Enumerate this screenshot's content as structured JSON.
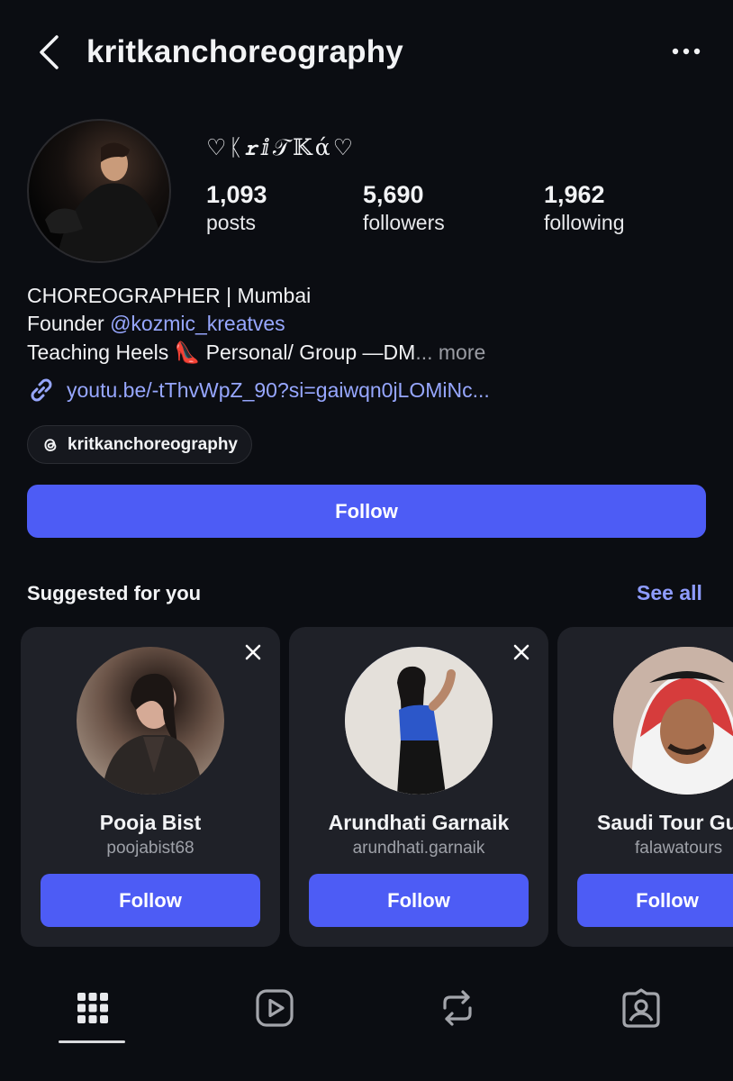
{
  "header": {
    "username": "kritkanchoreography",
    "back_icon": "chevron-left-icon",
    "more_icon": "more-horizontal-icon"
  },
  "profile": {
    "display_name": "♡ᛕ𝒓ⅈ𝒯𝕂ά♡",
    "stats": {
      "posts": {
        "value": "1,093",
        "label": "posts"
      },
      "followers": {
        "value": "5,690",
        "label": "followers"
      },
      "following": {
        "value": "1,962",
        "label": "following"
      }
    },
    "bio": {
      "line1": "CHOREOGRAPHER | Mumbai",
      "line2_prefix": "Founder ",
      "line2_mention": "@kozmic_kreatves",
      "line3": "Teaching Heels 👠 Personal/ Group —DM",
      "line3_more_ellipsis": "... ",
      "line3_more": "more"
    },
    "link": "youtu.be/-tThvWpZ_90?si=gaiwqn0jLOMiNc...",
    "threads_handle": "kritkanchoreography",
    "follow_label": "Follow"
  },
  "suggested": {
    "title": "Suggested for you",
    "see_all": "See all",
    "cards": [
      {
        "name": "Pooja Bist",
        "username": "poojabist68",
        "follow": "Follow"
      },
      {
        "name": "Arundhati Garnaik",
        "username": "arundhati.garnaik",
        "follow": "Follow"
      },
      {
        "name": "Saudi Tour Gu",
        "username": "falawatours",
        "follow": "Follow"
      }
    ]
  },
  "tabs": [
    "grid-icon",
    "reels-icon",
    "reposts-icon",
    "tagged-icon"
  ],
  "colors": {
    "background": "#0b0d12",
    "accent": "#4d5cf5",
    "link": "#97a7ff",
    "card": "#1f2128"
  }
}
